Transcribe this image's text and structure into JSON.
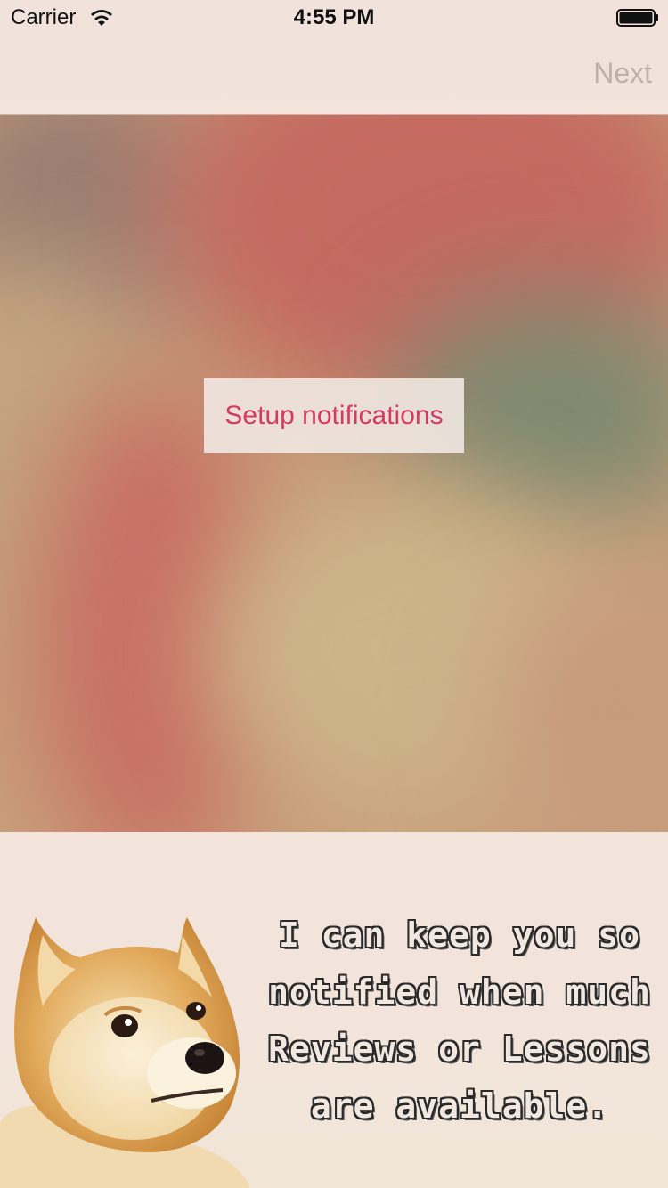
{
  "status_bar": {
    "carrier": "Carrier",
    "time": "4:55 PM",
    "wifi_icon": "wifi-icon",
    "battery_icon": "battery-icon"
  },
  "nav": {
    "next_label": "Next"
  },
  "hero": {
    "setup_button_label": "Setup notifications"
  },
  "caption": {
    "lines": [
      "I can keep you so",
      "notified when much",
      "Reviews or Lessons",
      "are available."
    ]
  },
  "image": {
    "icon": "doge-illustration"
  },
  "colors": {
    "accent": "#d43a63",
    "nav_disabled": "#bfb0ab",
    "background": "#f1e3db"
  }
}
